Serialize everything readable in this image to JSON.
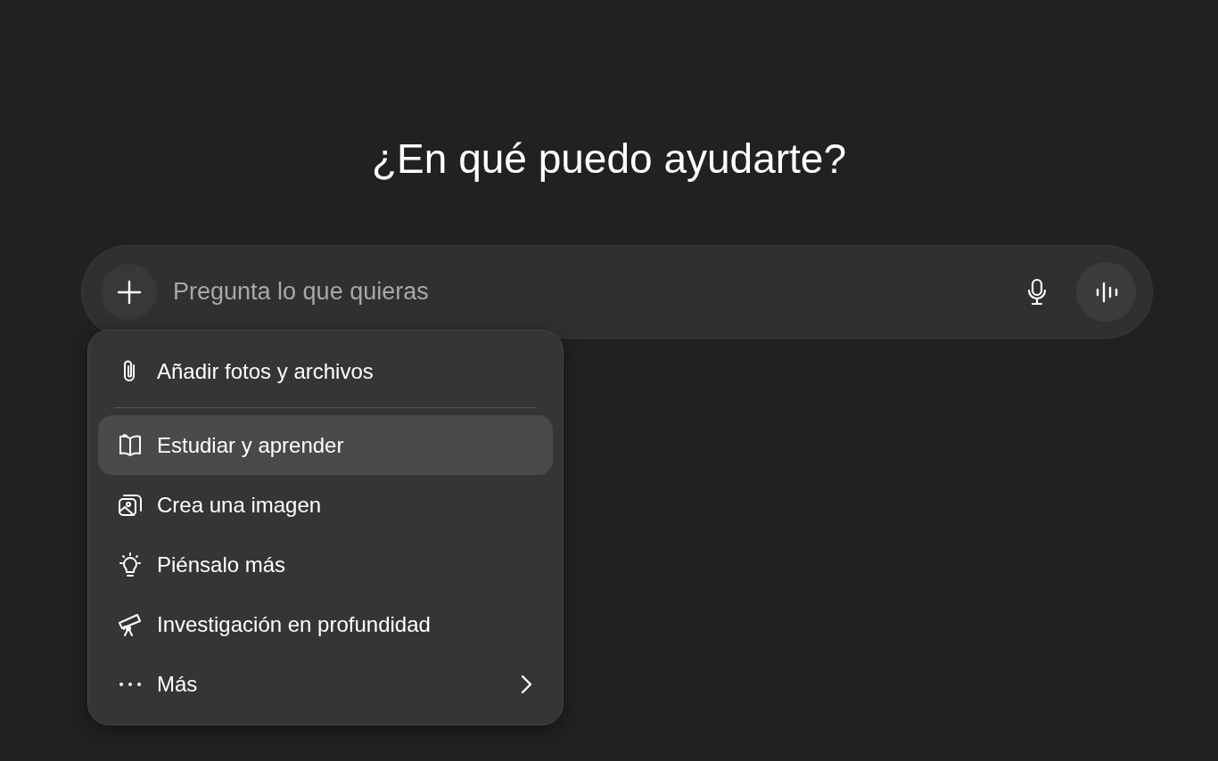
{
  "heading": "¿En qué puedo ayudarte?",
  "composer": {
    "placeholder": "Pregunta lo que quieras"
  },
  "menu": {
    "items": [
      {
        "label": "Añadir fotos y archivos",
        "selected": false,
        "divider_after": true,
        "submenu": false
      },
      {
        "label": "Estudiar y aprender",
        "selected": true,
        "divider_after": false,
        "submenu": false
      },
      {
        "label": "Crea una imagen",
        "selected": false,
        "divider_after": false,
        "submenu": false
      },
      {
        "label": "Piénsalo más",
        "selected": false,
        "divider_after": false,
        "submenu": false
      },
      {
        "label": "Investigación en profundidad",
        "selected": false,
        "divider_after": false,
        "submenu": false
      },
      {
        "label": "Más",
        "selected": false,
        "divider_after": false,
        "submenu": true
      }
    ]
  }
}
